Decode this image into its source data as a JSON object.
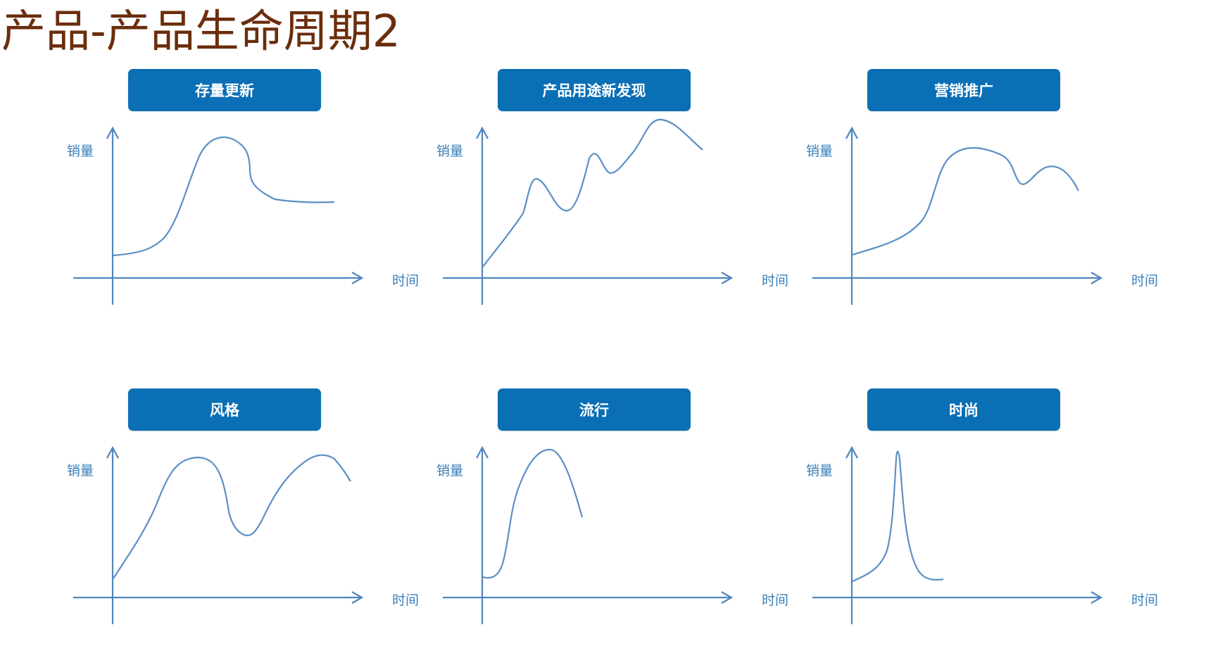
{
  "title": "产品-产品生命周期2",
  "axis": {
    "y_label": "销量",
    "x_label": "时间"
  },
  "panels": [
    {
      "label": "存量更新"
    },
    {
      "label": "产品用途新发现"
    },
    {
      "label": "营销推广"
    },
    {
      "label": "风格"
    },
    {
      "label": "流行"
    },
    {
      "label": "时尚"
    }
  ],
  "colors": {
    "button": "#0b6fb5",
    "axis": "#4f86bd",
    "curve": "#5b8fc4",
    "title": "#6b2d0c"
  }
}
